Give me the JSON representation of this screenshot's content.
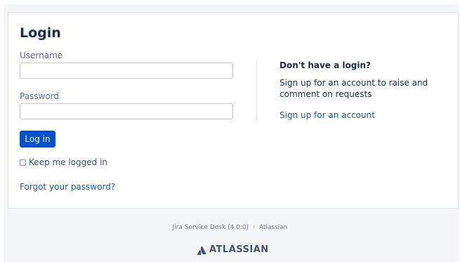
{
  "login": {
    "title": "Login",
    "username_label": "Username",
    "username_value": "",
    "password_label": "Password",
    "password_value": "",
    "submit_label": "Log in",
    "remember_label": "Keep me logged in",
    "remember_checked": false,
    "forgot_link": "Forgot your password?"
  },
  "signup": {
    "heading": "Don't have a login?",
    "description": "Sign up for an account to raise and comment on requests",
    "link": "Sign up for an account"
  },
  "footer": {
    "product": "Jira Service Desk (4.0.0)",
    "separator": "·",
    "vendor": "Atlassian",
    "brand": "ATLASSIAN",
    "brand_icon": "atlassian-logo-icon"
  },
  "colors": {
    "primary": "#0052cc",
    "link": "#0b5fad",
    "text": "#172b4d",
    "subtle_text": "#5e6c84",
    "background": "#f4f5f7",
    "border": "#dfe1e6"
  }
}
